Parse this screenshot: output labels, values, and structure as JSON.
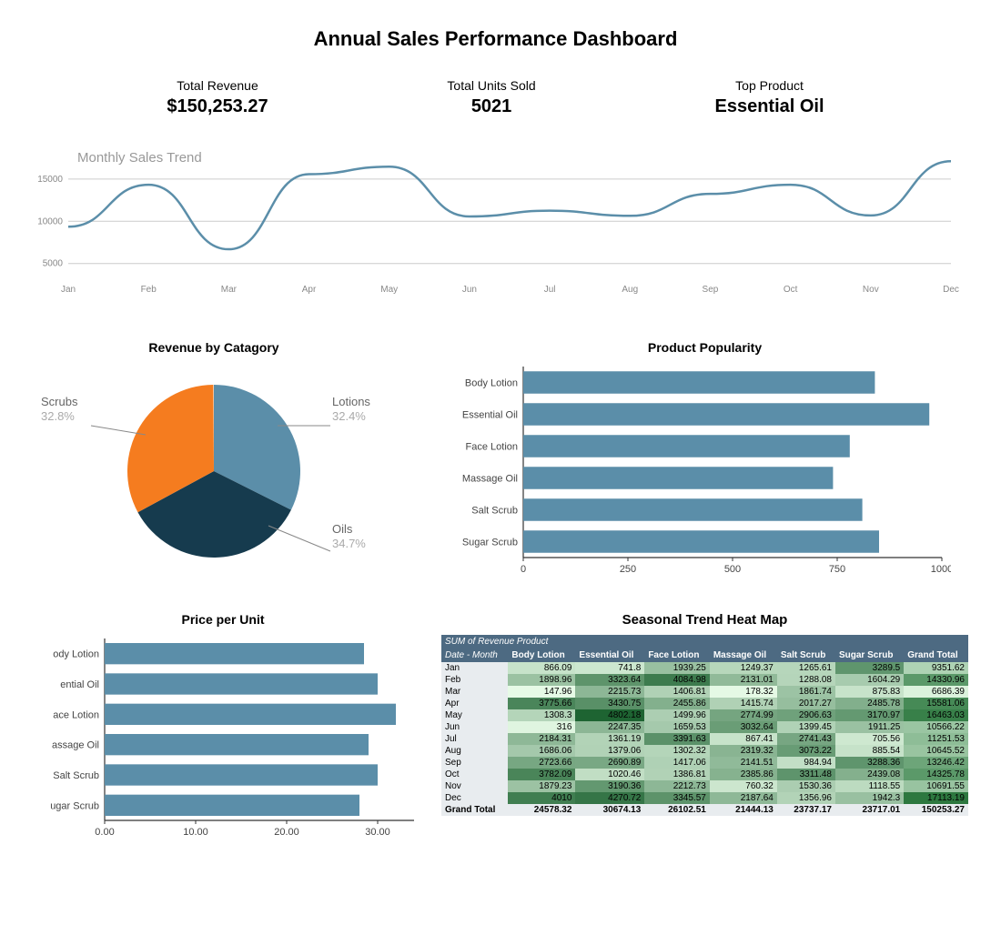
{
  "title": "Annual Sales Performance Dashboard",
  "kpis": {
    "revenue_label": "Total Revenue",
    "revenue_value": "$150,253.27",
    "units_label": "Total Units Sold",
    "units_value": "5021",
    "top_label": "Top Product",
    "top_value": "Essential Oil"
  },
  "line_title": "Monthly Sales Trend",
  "pie_title": "Revenue by Catagory",
  "popularity_title": "Product Popularity",
  "ppu_title": "Price per Unit",
  "heat_title": "Seasonal Trend Heat Map",
  "heat_preheader": "SUM of Revenue   Product",
  "heat_rowheader": "Date - Month",
  "heat_grandlabel": "Grand Total",
  "chart_data": [
    {
      "id": "monthly_trend",
      "type": "line",
      "title": "Monthly Sales Trend",
      "categories": [
        "Jan",
        "Feb",
        "Mar",
        "Apr",
        "May",
        "Jun",
        "Jul",
        "Aug",
        "Sep",
        "Oct",
        "Nov",
        "Dec"
      ],
      "values": [
        9351.62,
        14330.96,
        6686.39,
        15581.06,
        16463.03,
        10566.22,
        11251.53,
        10645.52,
        13246.42,
        14325.78,
        10691.55,
        17113.19
      ],
      "yticks": [
        5000,
        10000,
        15000
      ],
      "ylim": [
        4000,
        18000
      ]
    },
    {
      "id": "revenue_by_category",
      "type": "pie",
      "title": "Revenue by Catagory",
      "series": [
        {
          "name": "Lotions",
          "value": 32.4,
          "color": "#5b8ea9"
        },
        {
          "name": "Oils",
          "value": 34.7,
          "color": "#163b4e"
        },
        {
          "name": "Scrubs",
          "value": 32.8,
          "color": "#f57c1f"
        }
      ]
    },
    {
      "id": "product_popularity",
      "type": "bar",
      "orientation": "horizontal",
      "title": "Product Popularity",
      "categories": [
        "Body Lotion",
        "Essential Oil",
        "Face Lotion",
        "Massage Oil",
        "Salt Scrub",
        "Sugar Scrub"
      ],
      "values": [
        840,
        970,
        780,
        740,
        810,
        850
      ],
      "xticks": [
        0,
        250,
        500,
        750,
        1000
      ],
      "xlim": [
        0,
        1000
      ]
    },
    {
      "id": "price_per_unit",
      "type": "bar",
      "orientation": "horizontal",
      "title": "Price per Unit",
      "categories": [
        "Body Lotion",
        "Essential Oil",
        "Face Lotion",
        "Massage Oil",
        "Salt Scrub",
        "Sugar Scrub"
      ],
      "values": [
        28.5,
        30.0,
        32.0,
        29.0,
        30.0,
        28.0
      ],
      "xticks": [
        0.0,
        10.0,
        20.0,
        30.0
      ],
      "xlim": [
        0,
        34
      ]
    },
    {
      "id": "seasonal_heatmap",
      "type": "heatmap",
      "title": "Seasonal Trend Heat Map",
      "row_label": "Date - Month",
      "columns": [
        "Body Lotion",
        "Essential Oil",
        "Face Lotion",
        "Massage Oil",
        "Salt Scrub",
        "Sugar Scrub",
        "Grand Total"
      ],
      "rows": [
        {
          "month": "Jan",
          "cells": [
            866.09,
            741.8,
            1939.25,
            1249.37,
            1265.61,
            3289.5,
            9351.62
          ]
        },
        {
          "month": "Feb",
          "cells": [
            1898.96,
            3323.64,
            4084.98,
            2131.01,
            1288.08,
            1604.29,
            14330.96
          ]
        },
        {
          "month": "Mar",
          "cells": [
            147.96,
            2215.73,
            1406.81,
            178.32,
            1861.74,
            875.83,
            6686.39
          ]
        },
        {
          "month": "Apr",
          "cells": [
            3775.66,
            3430.75,
            2455.86,
            1415.74,
            2017.27,
            2485.78,
            15581.06
          ]
        },
        {
          "month": "May",
          "cells": [
            1308.3,
            4802.18,
            1499.96,
            2774.99,
            2906.63,
            3170.97,
            16463.03
          ]
        },
        {
          "month": "Jun",
          "cells": [
            316,
            2247.35,
            1659.53,
            3032.64,
            1399.45,
            1911.25,
            10566.22
          ]
        },
        {
          "month": "Jul",
          "cells": [
            2184.31,
            1361.19,
            3391.63,
            867.41,
            2741.43,
            705.56,
            11251.53
          ]
        },
        {
          "month": "Aug",
          "cells": [
            1686.06,
            1379.06,
            1302.32,
            2319.32,
            3073.22,
            885.54,
            10645.52
          ]
        },
        {
          "month": "Sep",
          "cells": [
            2723.66,
            2690.89,
            1417.06,
            2141.51,
            984.94,
            3288.36,
            13246.42
          ]
        },
        {
          "month": "Oct",
          "cells": [
            3782.09,
            1020.46,
            1386.81,
            2385.86,
            3311.48,
            2439.08,
            14325.78
          ]
        },
        {
          "month": "Nov",
          "cells": [
            1879.23,
            3190.36,
            2212.73,
            760.32,
            1530.36,
            1118.55,
            10691.55
          ]
        },
        {
          "month": "Dec",
          "cells": [
            4010,
            4270.72,
            3345.57,
            2187.64,
            1356.96,
            1942.3,
            17113.19
          ]
        }
      ],
      "grand_total": [
        24578.32,
        30674.13,
        26102.51,
        21444.13,
        23737.17,
        23717.01,
        150253.27
      ]
    }
  ]
}
